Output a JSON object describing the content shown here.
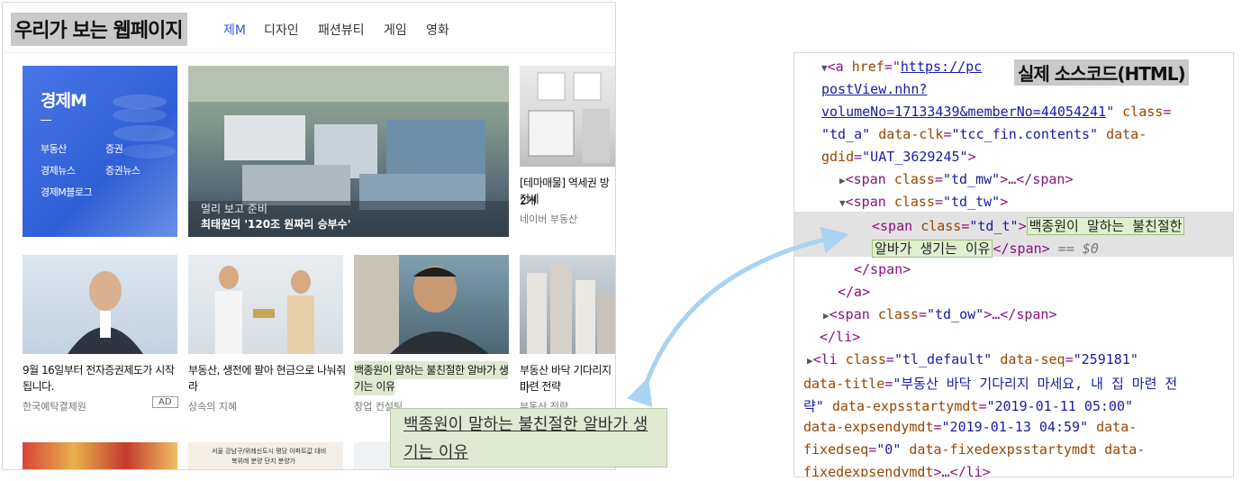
{
  "labels": {
    "webpage": "우리가 보는 웹페이지",
    "source": "실제 소스코드(HTML)"
  },
  "nav": {
    "tabs": [
      {
        "label": "제M",
        "active": true
      },
      {
        "label": "디자인",
        "active": false
      },
      {
        "label": "패션뷰티",
        "active": false
      },
      {
        "label": "게임",
        "active": false
      },
      {
        "label": "영화",
        "active": false
      }
    ]
  },
  "econ_box": {
    "title": "경제M",
    "links": [
      "부동산",
      "증권",
      "경제뉴스",
      "증권뉴스",
      "경제M블로그"
    ]
  },
  "cards": {
    "hero": {
      "overlay_line1": "멀리 보고 준비",
      "overlay_line2": "최태원의 '120조 원짜리 승부수'"
    },
    "interior": {
      "title_line1": "[테마매물] 역세권 방 2개",
      "title_line2": "전세",
      "source": "네이버 부동산"
    },
    "suit": {
      "title_line1": "9월 16일부터 전자증권제도가 시작",
      "title_line2": "됩니다.",
      "source": "한국예탁결제원",
      "badge": "AD"
    },
    "couple": {
      "title_line1": "부동산, 생전에 팔아 현금으로 나눠줘",
      "title_line2": "라",
      "source": "상속의 지혜"
    },
    "chef": {
      "title_line1": "백종원이 말하는 불친절한 알바가 생",
      "title_line2": "기는 이유",
      "source": "창업 컨설팅"
    },
    "apartments": {
      "title_line1": "부동산 바닥 기다리지 마",
      "title_line2": "마련 전략",
      "source": "부동산 전략"
    },
    "bottom_ad": {
      "line1": "서울 강남구/위례신도시 평당 아파트값 대비",
      "line2": "북위례 분양 단지 분양가"
    }
  },
  "callout": {
    "line1": "백종원이 말하는 불친절한 알바가 생",
    "line2": "기는 이유"
  },
  "code": {
    "l1": {
      "open": "<a ",
      "attr": "href",
      "eq": "=\"",
      "url": "https://pc"
    },
    "l2": {
      "url": "postView.nhn?"
    },
    "l3": {
      "url": "volumeNo=17133439&memberNo=44054241",
      "q": "\" ",
      "attr": "class",
      "eq": "="
    },
    "l4": {
      "val": "\"td_a\"",
      "attr": " data-clk",
      "eq": "=",
      "val2": "\"tcc_fin.contents\"",
      "attr2": " data-"
    },
    "l5": {
      "attr": "gdid",
      "eq": "=",
      "val": "\"UAT_3629245\"",
      "close": ">"
    },
    "l6": {
      "open": "<span ",
      "attr": "class",
      "eq": "=",
      "val": "\"td_mw\"",
      "rest": ">…</span>"
    },
    "l7": {
      "open": "<span ",
      "attr": "class",
      "eq": "=",
      "val": "\"td_tw\"",
      "close": ">"
    },
    "l8": {
      "open": "<span ",
      "attr": "class",
      "eq": "=",
      "val": "\"td_t\"",
      "close": ">",
      "text": "백종원이 말하는 불친절한"
    },
    "l9": {
      "text": "알바가 생기는 이유",
      "close": "</span>",
      "dim": " == $0"
    },
    "l10": {
      "close": "</span>"
    },
    "l11": {
      "close": "</a>"
    },
    "l12": {
      "open": "<span ",
      "attr": "class",
      "eq": "=",
      "val": "\"td_ow\"",
      "rest": ">…</span>"
    },
    "l13": {
      "close": "</li>"
    },
    "l14": {
      "open": "<li ",
      "attr": "class",
      "eq": "=",
      "val": "\"tl_default\"",
      "attr2": " data-seq",
      "eq2": "=",
      "val2": "\"259181\""
    },
    "l15": {
      "attr": "data-title",
      "eq": "=",
      "val": "\"부동산 바닥 기다리지 마세요, 내 집 마련 전"
    },
    "l16": {
      "val": "략\"",
      "attr": " data-expsstartymdt",
      "eq": "=",
      "val2": "\"2019-01-11 05:00\""
    },
    "l17": {
      "attr": "data-expsendymdt",
      "eq": "=",
      "val": "\"2019-01-13 04:59\"",
      "attr2": " data-"
    },
    "l18": {
      "attr": "fixedseq",
      "eq": "=",
      "val": "\"0\"",
      "attr2": " data-fixedexpsstartymdt data-"
    },
    "l19": {
      "attr": "fixedexpsendymdt",
      "rest": ">…</li>"
    }
  },
  "colors": {
    "accent": "#2b61d8",
    "highlight": "#dde9d0",
    "arrow": "#a9d3f0",
    "tag": "#881280",
    "attr": "#994500",
    "value": "#1a1aa6"
  }
}
